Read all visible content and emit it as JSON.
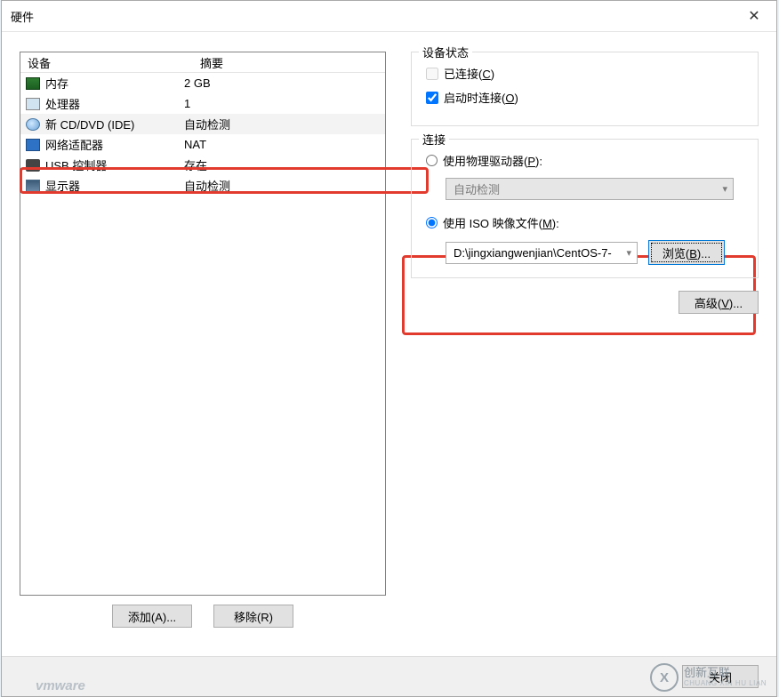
{
  "titlebar": {
    "title": "硬件"
  },
  "list": {
    "headers": {
      "device": "设备",
      "summary": "摘要"
    },
    "rows": [
      {
        "name": "内存",
        "summary": "2 GB"
      },
      {
        "name": "处理器",
        "summary": "1"
      },
      {
        "name": "新 CD/DVD (IDE)",
        "summary": "自动检测"
      },
      {
        "name": "网络适配器",
        "summary": "NAT"
      },
      {
        "name": "USB 控制器",
        "summary": "存在"
      },
      {
        "name": "显示器",
        "summary": "自动检测"
      }
    ],
    "add": "添加(A)...",
    "remove": "移除(R)"
  },
  "right": {
    "status": {
      "legend": "设备状态",
      "connected": "已连接(C)",
      "connect_on": "启动时连接(O)"
    },
    "connection": {
      "legend": "连接",
      "phys": "使用物理驱动器(P):",
      "phys_combo": "自动检测",
      "iso": "使用 ISO 映像文件(M):",
      "iso_path": "D:\\jingxiangwenjian\\CentOS-7-",
      "browse": "浏览(B)..."
    },
    "advanced": "高级(V)..."
  },
  "footer": {
    "close": "关闭"
  },
  "watermark": {
    "cn": "创新互联",
    "en": "CHUANG XIN HU LIAN"
  },
  "vm": "vmware"
}
